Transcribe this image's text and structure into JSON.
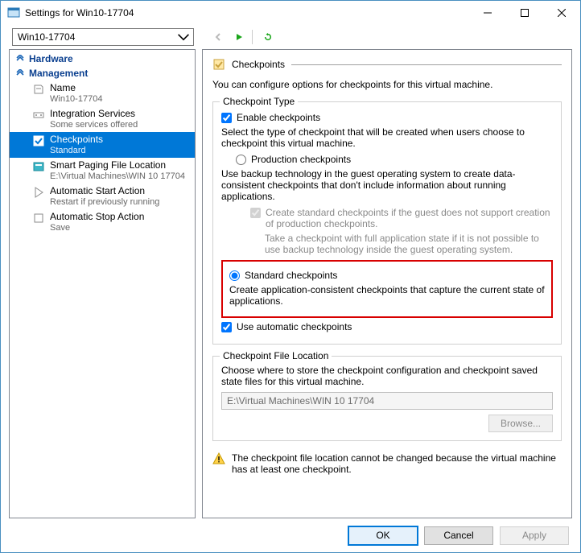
{
  "window": {
    "title": "Settings for Win10-17704"
  },
  "toolbar": {
    "combo_value": "Win10-17704"
  },
  "sidebar": {
    "sections": [
      {
        "label": "Hardware"
      },
      {
        "label": "Management"
      }
    ],
    "items": [
      {
        "icon": "name",
        "label": "Name",
        "sub": "Win10-17704"
      },
      {
        "icon": "integ",
        "label": "Integration Services",
        "sub": "Some services offered"
      },
      {
        "icon": "chk",
        "label": "Checkpoints",
        "sub": "Standard",
        "selected": true
      },
      {
        "icon": "smart",
        "label": "Smart Paging File Location",
        "sub": "E:\\Virtual Machines\\WIN 10 17704"
      },
      {
        "icon": "start",
        "label": "Automatic Start Action",
        "sub": "Restart if previously running"
      },
      {
        "icon": "stop",
        "label": "Automatic Stop Action",
        "sub": "Save"
      }
    ]
  },
  "panel": {
    "title": "Checkpoints",
    "intro": "You can configure options for checkpoints for this virtual machine.",
    "type_group": {
      "legend": "Checkpoint Type",
      "enable_label": "Enable checkpoints",
      "select_text": "Select the type of checkpoint that will be created when users choose to checkpoint this virtual machine.",
      "prod_label": "Production checkpoints",
      "prod_desc": "Use backup technology in the guest operating system to create data-consistent checkpoints that don't include information about running applications.",
      "fallback_label": "Create standard checkpoints if the guest does not support creation of production checkpoints.",
      "fallback_note": "Take a checkpoint with full application state if it is not possible to use backup technology inside the guest operating system.",
      "std_label": "Standard checkpoints",
      "std_desc": "Create application-consistent checkpoints that capture the current state of applications.",
      "auto_label": "Use automatic checkpoints"
    },
    "loc_group": {
      "legend": "Checkpoint File Location",
      "desc": "Choose where to store the checkpoint configuration and checkpoint saved state files for this virtual machine.",
      "path": "E:\\Virtual Machines\\WIN 10 17704",
      "browse_label": "Browse..."
    },
    "warning": "The checkpoint file location cannot be changed because the virtual machine has at least one checkpoint."
  },
  "footer": {
    "ok": "OK",
    "cancel": "Cancel",
    "apply": "Apply"
  }
}
